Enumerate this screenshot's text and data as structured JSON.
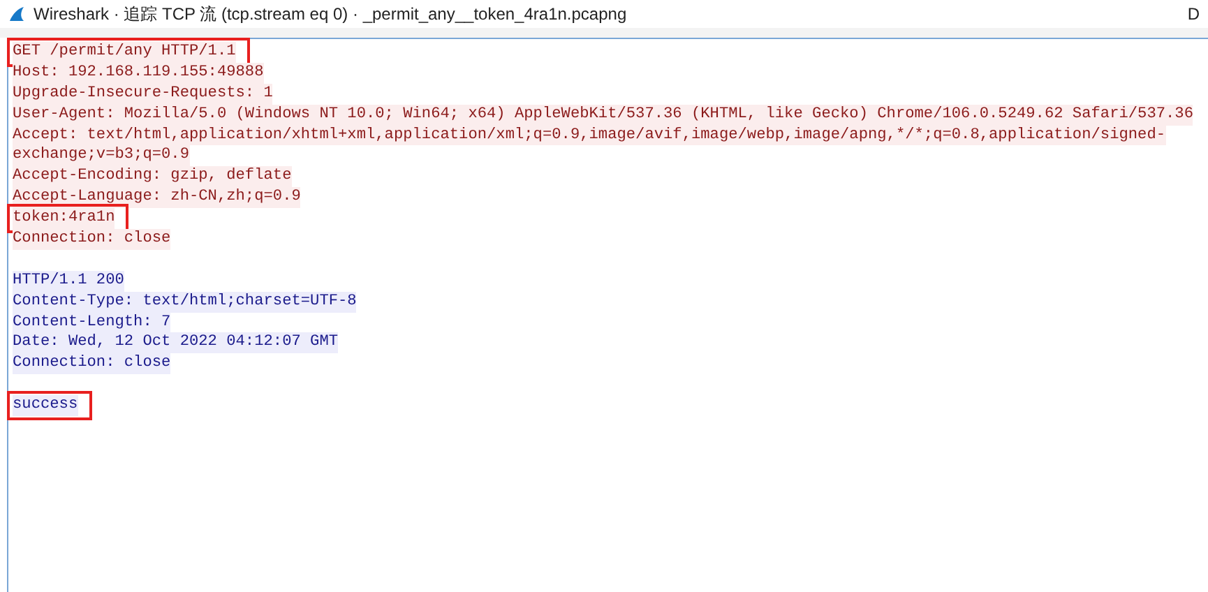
{
  "window": {
    "title": "Wireshark · 追踪 TCP 流 (tcp.stream eq 0) · _permit_any__token_4ra1n.pcapng",
    "edge_text": "D"
  },
  "stream": [
    {
      "kind": "client",
      "text": "GET /permit/any HTTP/1.1",
      "highlighted": true
    },
    {
      "kind": "client",
      "text": "Host: 192.168.119.155:49888",
      "highlighted": false
    },
    {
      "kind": "client",
      "text": "Upgrade-Insecure-Requests: 1",
      "highlighted": false
    },
    {
      "kind": "client",
      "text": "User-Agent: Mozilla/5.0 (Windows NT 10.0; Win64; x64) AppleWebKit/537.36 (KHTML, like Gecko) Chrome/106.0.5249.62 Safari/537.36",
      "highlighted": false
    },
    {
      "kind": "client",
      "text": "Accept: text/html,application/xhtml+xml,application/xml;q=0.9,image/avif,image/webp,image/apng,*/*;q=0.8,application/signed-",
      "highlighted": false
    },
    {
      "kind": "client",
      "text": "exchange;v=b3;q=0.9",
      "highlighted": false
    },
    {
      "kind": "client",
      "text": "Accept-Encoding: gzip, deflate",
      "highlighted": false
    },
    {
      "kind": "client",
      "text": "Accept-Language: zh-CN,zh;q=0.9",
      "highlighted": false
    },
    {
      "kind": "client",
      "text": "token:4ra1n",
      "highlighted": true
    },
    {
      "kind": "client",
      "text": "Connection: close",
      "highlighted": false
    },
    {
      "kind": "blank"
    },
    {
      "kind": "server",
      "text": "HTTP/1.1 200",
      "highlighted": false
    },
    {
      "kind": "server",
      "text": "Content-Type: text/html;charset=UTF-8",
      "highlighted": false
    },
    {
      "kind": "server",
      "text": "Content-Length: 7",
      "highlighted": false
    },
    {
      "kind": "server",
      "text": "Date: Wed, 12 Oct 2022 04:12:07 GMT",
      "highlighted": false
    },
    {
      "kind": "server",
      "text": "Connection: close",
      "highlighted": false
    },
    {
      "kind": "blank"
    },
    {
      "kind": "server",
      "text": "success",
      "highlighted": true
    }
  ]
}
